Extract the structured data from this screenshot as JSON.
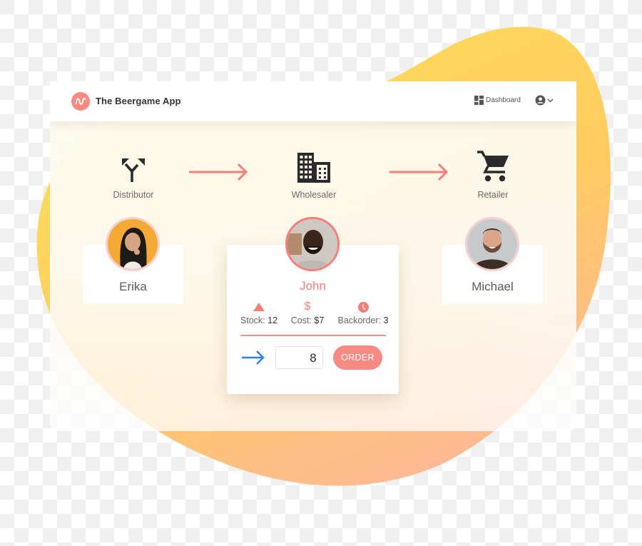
{
  "app": {
    "title": "The Beergame App",
    "logo_icon": "wave-icon",
    "accent_color": "#f88a82"
  },
  "header": {
    "nav": [
      {
        "label": "Dashboard",
        "icon": "dashboard-grid-icon"
      }
    ],
    "user_menu": {
      "icon": "user-circle-icon",
      "caret": "chevron-down-icon"
    }
  },
  "supply_chain": {
    "roles": [
      {
        "label": "Distributor",
        "icon": "split-arrows-icon"
      },
      {
        "label": "Wholesaler",
        "icon": "building-icon"
      },
      {
        "label": "Retailer",
        "icon": "shopping-cart-icon"
      }
    ],
    "flow_arrow_icon": "arrow-right-icon",
    "flow_color": "#f57f78"
  },
  "players": [
    {
      "name": "Erika",
      "role": "Distributor",
      "active": false
    },
    {
      "name": "John",
      "role": "Wholesaler",
      "active": true,
      "stats": [
        {
          "icon": "triangle-up-icon",
          "label": "Stock:",
          "value": "12"
        },
        {
          "icon": "dollar-icon",
          "label": "Cost:",
          "value": "$7"
        },
        {
          "icon": "clock-icon",
          "label": "Backorder:",
          "value": "3"
        }
      ],
      "order": {
        "arrow_icon": "arrow-right-icon",
        "quantity": "8",
        "button_label": "ORDER"
      }
    },
    {
      "name": "Michael",
      "role": "Retailer",
      "active": false
    }
  ],
  "colors": {
    "accent": "#f88a84",
    "order_arrow": "#2f7fe6",
    "icon_dark": "#2b2b2b"
  }
}
